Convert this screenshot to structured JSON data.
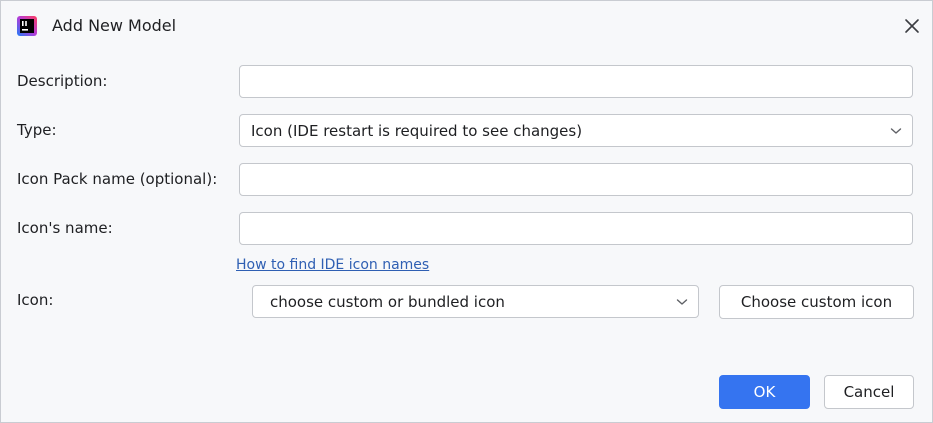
{
  "dialog": {
    "title": "Add New Model",
    "app_icon": "intellij-app-icon",
    "close_icon": "close-icon"
  },
  "form": {
    "description": {
      "label": "Description:",
      "value": ""
    },
    "type": {
      "label": "Type:",
      "selected": "Icon (IDE restart is required to see changes)"
    },
    "icon_pack": {
      "label": "Icon Pack name (optional):",
      "value": ""
    },
    "icon_name": {
      "label": "Icon's name:",
      "value": ""
    },
    "help_link": "How to find IDE icon names",
    "icon": {
      "label": "Icon:",
      "selected": "choose custom or bundled icon",
      "custom_button": "Choose custom icon"
    }
  },
  "buttons": {
    "ok": "OK",
    "cancel": "Cancel"
  },
  "colors": {
    "background": "#f7f8fa",
    "accent": "#3574f0",
    "link": "#2f5fb3",
    "border": "#c4c7cc"
  }
}
